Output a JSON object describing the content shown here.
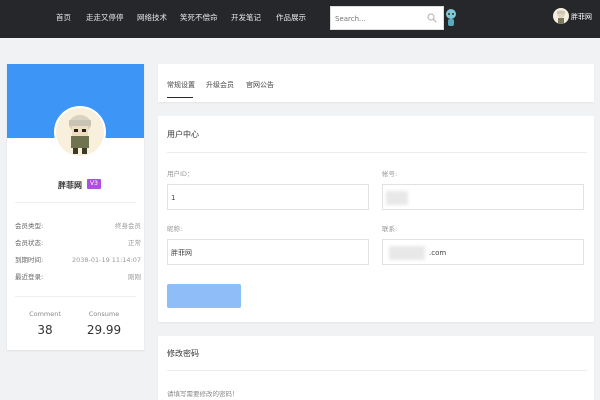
{
  "nav": {
    "items": [
      {
        "label": "首页"
      },
      {
        "label": "走走又停停"
      },
      {
        "label": "网络技术"
      },
      {
        "label": "笑死不偿命"
      },
      {
        "label": "开发笔记"
      },
      {
        "label": "作品展示"
      }
    ],
    "search_placeholder": "Search...",
    "user_name": "胖菲网"
  },
  "profile": {
    "name": "胖菲网",
    "vip_badge": "V3",
    "info": [
      {
        "key": "会员类型:",
        "value": "终身会员"
      },
      {
        "key": "会员状态:",
        "value": "正常"
      },
      {
        "key": "到期时间:",
        "value": "2038-01-19 11:14:07"
      },
      {
        "key": "最近登录:",
        "value": "刚刚"
      }
    ],
    "stats": [
      {
        "label": "Comment",
        "value": "38"
      },
      {
        "label": "Consume",
        "value": "29.99"
      }
    ]
  },
  "tabs": [
    {
      "label": "常规设置"
    },
    {
      "label": "升级会员"
    },
    {
      "label": "官网公告"
    }
  ],
  "user_center": {
    "title": "用户中心",
    "uid_label": "用户ID：",
    "uid_value": "1",
    "account_label": "帐号:",
    "account_value": "",
    "nickname_label": "昵称:",
    "nickname_value": "胖菲网",
    "contact_label": "联系:",
    "contact_value": ".com"
  },
  "password": {
    "title": "修改密码",
    "hint": "请填写需要修改的密码！"
  },
  "colors": {
    "topbar": "#26272b",
    "banner": "#3d95f5",
    "vip": "#b04de6",
    "button": "#8fbdf7"
  }
}
